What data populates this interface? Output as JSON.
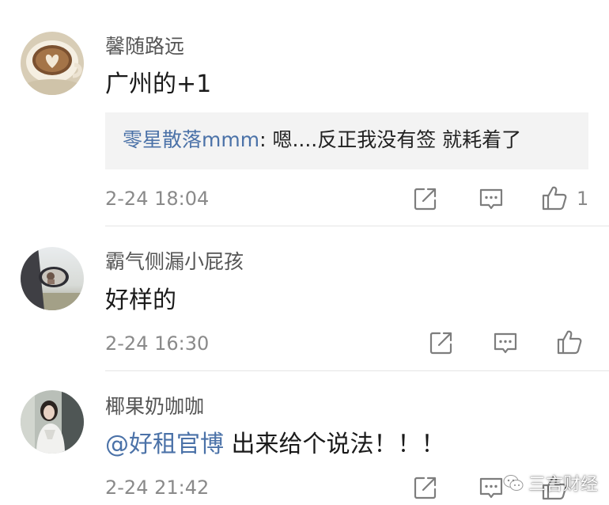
{
  "comments": [
    {
      "username": "馨随路远",
      "text": "广州的+1",
      "reply": {
        "user": "零星散落mmm",
        "separator": ":",
        "text": " 嗯....反正我没有签 就耗着了"
      },
      "timestamp": "2-24 18:04",
      "like_count": "1",
      "avatar_icon": "latte-art-avatar"
    },
    {
      "username": "霸气侧漏小屁孩",
      "text": "好样的",
      "timestamp": "2-24 16:30",
      "like_count": "",
      "avatar_icon": "car-mirror-avatar"
    },
    {
      "username": "椰果奶咖咖",
      "mention": "@好租官博",
      "text": " 出来给个说法！！！",
      "timestamp": "2-24 21:42",
      "like_count": "",
      "avatar_icon": "portrait-avatar"
    }
  ],
  "actions": {
    "repost_icon": "share-icon",
    "comment_icon": "comment-icon",
    "like_icon": "thumbs-up-icon"
  },
  "watermark": {
    "text": "三言财经",
    "icon": "wechat-icon"
  },
  "colors": {
    "mention": "#4b72a8",
    "timestamp": "#8a8a8a",
    "reply_background": "#f3f3f3"
  }
}
